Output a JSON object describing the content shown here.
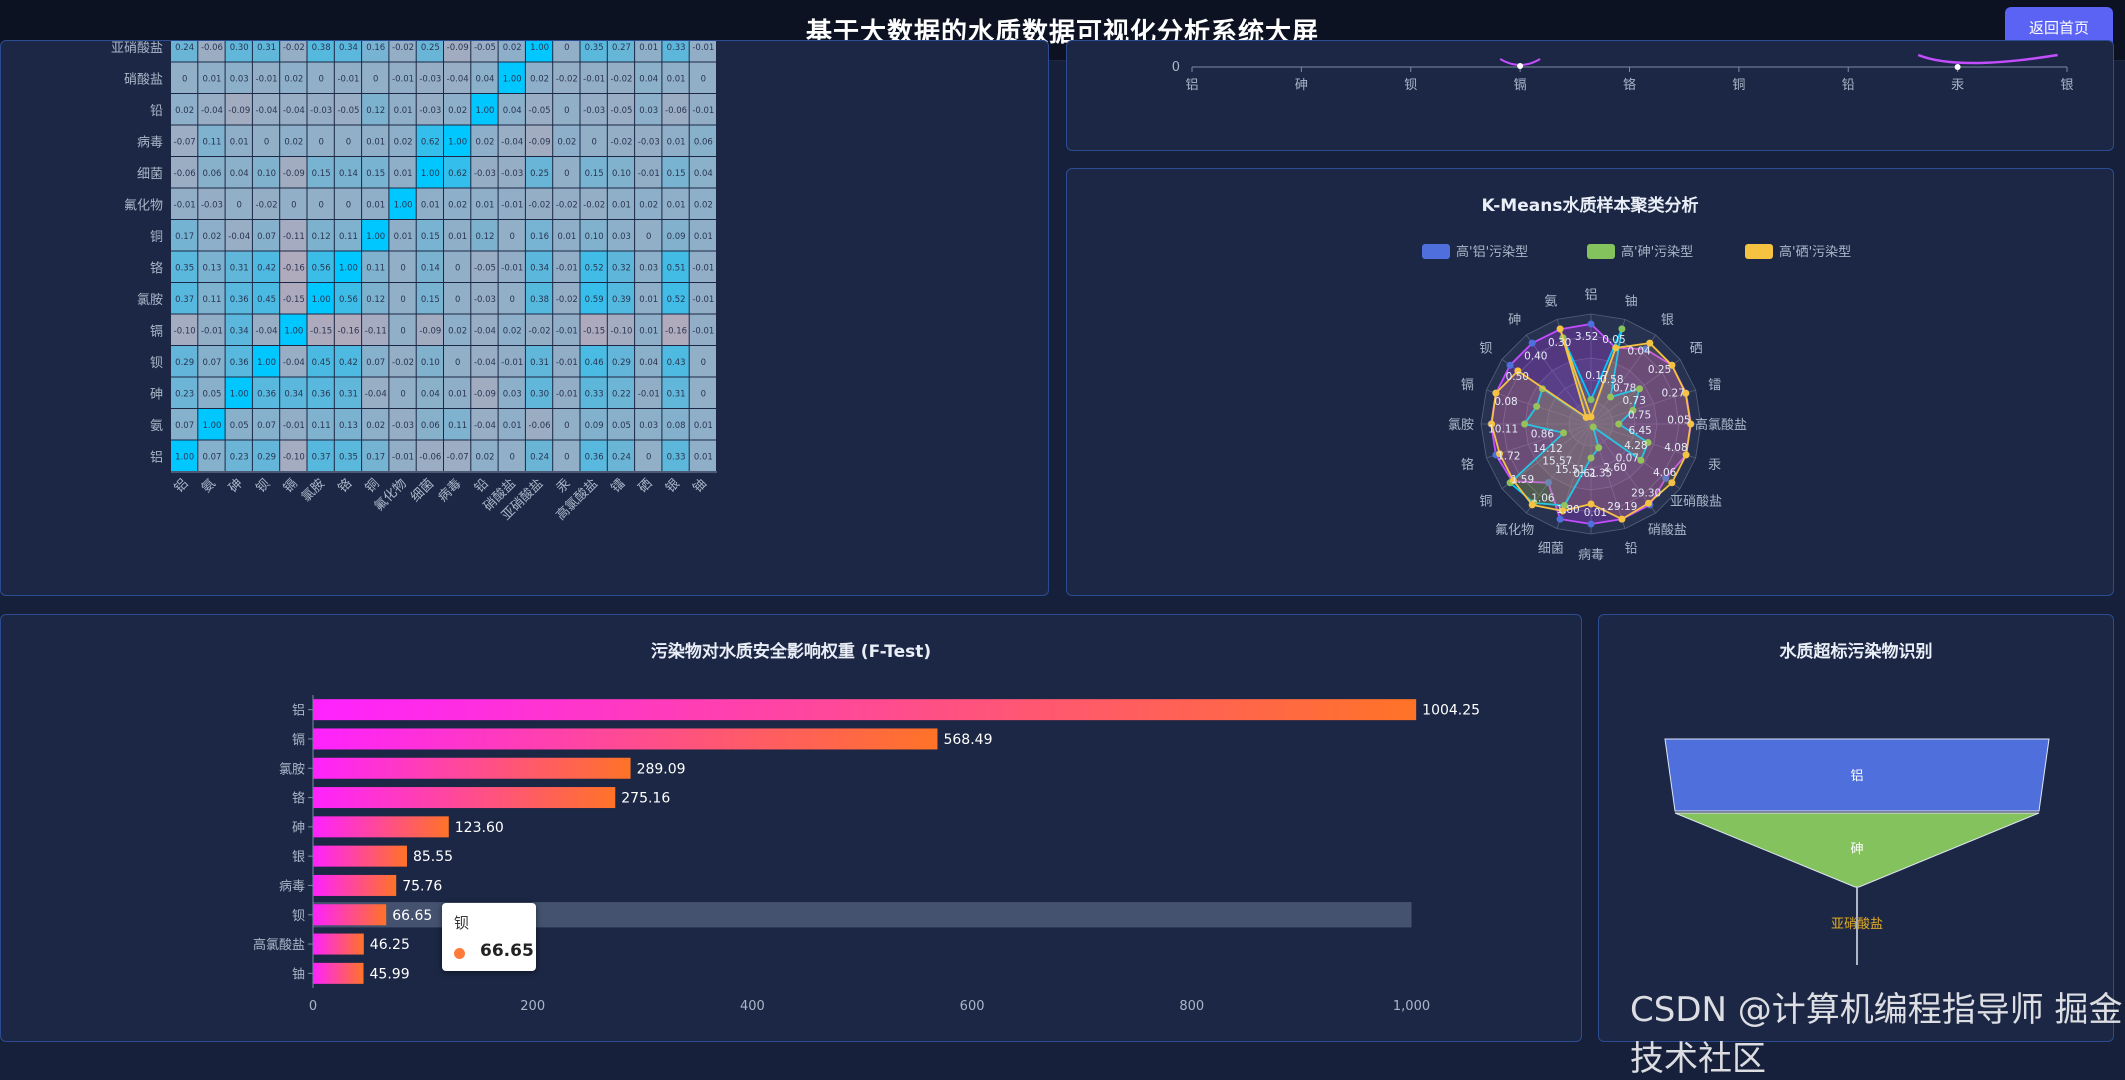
{
  "header": {
    "title": "基于大数据的水质数据可视化分析系统大屏",
    "home_button": "返回首页"
  },
  "colors": {
    "blue": "#4e6fdc",
    "green": "#84c25e",
    "yellow": "#f5c242",
    "bar_start": "#ff22ff",
    "bar_end": "#ff7327",
    "heat_high": "#00c7ff",
    "heat_low": "#b9a8b8"
  },
  "heatmap": {
    "labels": [
      "铝",
      "氨",
      "砷",
      "钡",
      "镉",
      "氯胺",
      "铬",
      "铜",
      "氟化物",
      "细菌",
      "病毒",
      "铅",
      "硝酸盐",
      "亚硝酸盐",
      "汞",
      "高氯酸盐",
      "镭",
      "硒",
      "银",
      "铀"
    ],
    "rows": [
      {
        "label": "亚硝酸盐",
        "values": [
          "0.24",
          "-0.06",
          "0.30",
          "0.31",
          "-0.02",
          "0.38",
          "0.34",
          "0.16",
          "-0.02",
          "0.25",
          "-0.09",
          "-0.05",
          "0.02",
          "1.00",
          "0",
          "0.35",
          "0.27",
          "0.01",
          "0.33",
          "-0.01"
        ]
      },
      {
        "label": "硝酸盐",
        "values": [
          "0",
          "0.01",
          "0.03",
          "-0.01",
          "0.02",
          "0",
          "-0.01",
          "0",
          "-0.01",
          "-0.03",
          "-0.04",
          "0.04",
          "1.00",
          "0.02",
          "-0.02",
          "-0.01",
          "-0.02",
          "0.04",
          "0.01",
          "0"
        ]
      },
      {
        "label": "铅",
        "values": [
          "0.02",
          "-0.04",
          "-0.09",
          "-0.04",
          "-0.04",
          "-0.03",
          "-0.05",
          "0.12",
          "0.01",
          "-0.03",
          "0.02",
          "1.00",
          "0.04",
          "-0.05",
          "0",
          "-0.03",
          "-0.05",
          "0.03",
          "-0.06",
          "-0.01"
        ]
      },
      {
        "label": "病毒",
        "values": [
          "-0.07",
          "0.11",
          "0.01",
          "0",
          "0.02",
          "0",
          "0",
          "0.01",
          "0.02",
          "0.62",
          "1.00",
          "0.02",
          "-0.04",
          "-0.09",
          "0.02",
          "0",
          "-0.02",
          "-0.03",
          "0.01",
          "0.06"
        ]
      },
      {
        "label": "细菌",
        "values": [
          "-0.06",
          "0.06",
          "0.04",
          "0.10",
          "-0.09",
          "0.15",
          "0.14",
          "0.15",
          "0.01",
          "1.00",
          "0.62",
          "-0.03",
          "-0.03",
          "0.25",
          "0",
          "0.15",
          "0.10",
          "-0.01",
          "0.15",
          "0.04"
        ]
      },
      {
        "label": "氟化物",
        "values": [
          "-0.01",
          "-0.03",
          "0",
          "-0.02",
          "0",
          "0",
          "0",
          "0.01",
          "1.00",
          "0.01",
          "0.02",
          "0.01",
          "-0.01",
          "-0.02",
          "-0.02",
          "-0.02",
          "0.01",
          "0.02",
          "0.01",
          "0.02"
        ]
      },
      {
        "label": "铜",
        "values": [
          "0.17",
          "0.02",
          "-0.04",
          "0.07",
          "-0.11",
          "0.12",
          "0.11",
          "1.00",
          "0.01",
          "0.15",
          "0.01",
          "0.12",
          "0",
          "0.16",
          "0.01",
          "0.10",
          "0.03",
          "0",
          "0.09",
          "0.01"
        ]
      },
      {
        "label": "铬",
        "values": [
          "0.35",
          "0.13",
          "0.31",
          "0.42",
          "-0.16",
          "0.56",
          "1.00",
          "0.11",
          "0",
          "0.14",
          "0",
          "-0.05",
          "-0.01",
          "0.34",
          "-0.01",
          "0.52",
          "0.32",
          "0.03",
          "0.51",
          "-0.01"
        ]
      },
      {
        "label": "氯胺",
        "values": [
          "0.37",
          "0.11",
          "0.36",
          "0.45",
          "-0.15",
          "1.00",
          "0.56",
          "0.12",
          "0",
          "0.15",
          "0",
          "-0.03",
          "0",
          "0.38",
          "-0.02",
          "0.59",
          "0.39",
          "0.01",
          "0.52",
          "-0.01"
        ]
      },
      {
        "label": "镉",
        "values": [
          "-0.10",
          "-0.01",
          "0.34",
          "-0.04",
          "1.00",
          "-0.15",
          "-0.16",
          "-0.11",
          "0",
          "-0.09",
          "0.02",
          "-0.04",
          "0.02",
          "-0.02",
          "-0.01",
          "-0.15",
          "-0.10",
          "0.01",
          "-0.16",
          "-0.01"
        ]
      },
      {
        "label": "钡",
        "values": [
          "0.29",
          "0.07",
          "0.36",
          "1.00",
          "-0.04",
          "0.45",
          "0.42",
          "0.07",
          "-0.02",
          "0.10",
          "0",
          "-0.04",
          "-0.01",
          "0.31",
          "-0.01",
          "0.46",
          "0.29",
          "0.04",
          "0.43",
          "0"
        ]
      },
      {
        "label": "砷",
        "values": [
          "0.23",
          "0.05",
          "1.00",
          "0.36",
          "0.34",
          "0.36",
          "0.31",
          "-0.04",
          "0",
          "0.04",
          "0.01",
          "-0.09",
          "0.03",
          "0.30",
          "-0.01",
          "0.33",
          "0.22",
          "-0.01",
          "0.31",
          "0"
        ]
      },
      {
        "label": "氨",
        "values": [
          "0.07",
          "1.00",
          "0.05",
          "0.07",
          "-0.01",
          "0.11",
          "0.13",
          "0.02",
          "-0.03",
          "0.06",
          "0.11",
          "-0.04",
          "0.01",
          "-0.06",
          "0",
          "0.09",
          "0.05",
          "0.03",
          "0.08",
          "0.01"
        ]
      },
      {
        "label": "铝",
        "values": [
          "1.00",
          "0.07",
          "0.23",
          "0.29",
          "-0.10",
          "0.37",
          "0.35",
          "0.17",
          "-0.01",
          "-0.06",
          "-0.07",
          "0.02",
          "0",
          "0.24",
          "0",
          "0.36",
          "0.24",
          "0",
          "0.33",
          "0.01"
        ]
      }
    ]
  },
  "topright": {
    "ytick": "0",
    "labels": [
      "铝",
      "砷",
      "钡",
      "镉",
      "铬",
      "铜",
      "铅",
      "汞",
      "银"
    ]
  },
  "kmeans": {
    "title": "K-Means水质样本聚类分析",
    "legend": [
      "高'铝'污染型",
      "高'砷'污染型",
      "高'硒'污染型"
    ],
    "axes": [
      "铝",
      "铀",
      "银",
      "硒",
      "镭",
      "高氯酸盐",
      "汞",
      "亚硝酸盐",
      "硝酸盐",
      "铅",
      "病毒",
      "细菌",
      "氟化物",
      "铜",
      "铬",
      "氯胺",
      "镉",
      "钡",
      "砷",
      "氨"
    ],
    "series": [
      {
        "name": "高'铝'污染型",
        "values": [
          3.52,
          0.04,
          0.25,
          0.05,
          4.08,
          29.3,
          0.01,
          1.59,
          10.11,
          0.08,
          0.5,
          0.35,
          0.58,
          0.73,
          0.52,
          6.45,
          0.07,
          2.6,
          0.61,
          15.51
        ]
      },
      {
        "name": "高'砷'污染型",
        "values": [
          0.86,
          0.05,
          0.09,
          0.03,
          1.8,
          8.14,
          0.006,
          1.06,
          0.38,
          0.02,
          0.17,
          0.3,
          0.78,
          0.75,
          0.15,
          4.28,
          0.04,
          1.56,
          0.05,
          14.12
        ]
      },
      {
        "name": "高'硒'污染型",
        "values": [
          0.25,
          0.04,
          0.27,
          0.05,
          4.06,
          29.19,
          0.01,
          1.72,
          9.9,
          0.08,
          0.4,
          0.32,
          0.8,
          0.72,
          0.5,
          6.41,
          0.07,
          2.35,
          0.05,
          15.57
        ]
      }
    ],
    "printed_values": [
      "3.52",
      "0.05",
      "0.04",
      "0.25",
      "0.27",
      "0.05",
      "4.08",
      "4.06",
      "29.30",
      "29.19",
      "0.01",
      "1.80",
      "1.06",
      "1.59",
      "1.72",
      "10.11",
      "0.08",
      "0.50",
      "0.40",
      "0.30",
      "0.17",
      "0.58",
      "0.78",
      "0.73",
      "0.75",
      "6.45",
      "4.28",
      "0.07",
      "2.60",
      "2.35",
      "0.61",
      "15.51",
      "15.57",
      "14.12",
      "0.86"
    ]
  },
  "ftest": {
    "title": "污染物对水质安全影响权重 (F-Test)",
    "chart_data": {
      "type": "bar",
      "categories": [
        "铝",
        "镉",
        "氯胺",
        "铬",
        "砷",
        "银",
        "病毒",
        "钡",
        "高氯酸盐",
        "铀"
      ],
      "values": [
        1004.25,
        568.49,
        289.09,
        275.16,
        123.6,
        85.55,
        75.76,
        66.65,
        46.25,
        45.99
      ],
      "value_labels": [
        "1004.25",
        "568.49",
        "289.09",
        "275.16",
        "123.60",
        "85.55",
        "75.76",
        "66.65",
        "46.25",
        "45.99"
      ],
      "xlim": [
        0,
        1000
      ],
      "xticks": [
        "0",
        "200",
        "400",
        "600",
        "800",
        "1,000"
      ],
      "highlight_index": 7
    },
    "tooltip": {
      "name": "钡",
      "value": "66.65"
    }
  },
  "funnel": {
    "title": "水质超标污染物识别",
    "items": [
      {
        "label": "铝",
        "color": "#4e6fdc"
      },
      {
        "label": "砷",
        "color": "#84c25e"
      },
      {
        "label": "亚硝酸盐",
        "color": "#f5c242"
      }
    ]
  },
  "watermark": "CSDN @计算机编程指导师  掘金技术社区"
}
